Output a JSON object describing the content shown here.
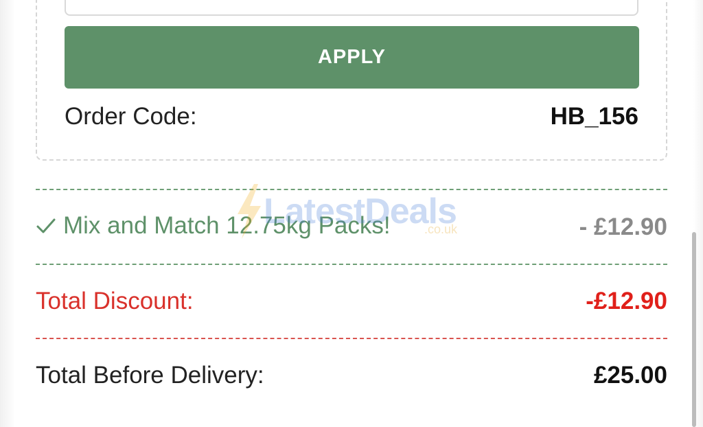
{
  "promo": {
    "input_value": "",
    "apply_label": "APPLY",
    "order_code_label": "Order Code:",
    "order_code_value": "HB_156"
  },
  "summary": {
    "promotion_label": "Mix and Match 12.75kg Packs!",
    "promotion_amount": "- £12.90",
    "total_discount_label": "Total Discount:",
    "total_discount_amount": "-£12.90",
    "total_before_delivery_label": "Total Before Delivery:",
    "total_before_delivery_amount": "£25.00"
  },
  "watermark": {
    "brand": "LatestDeals",
    "domain": ".co.uk"
  },
  "icons": {
    "check": "check-icon",
    "bolt": "lightning-bolt-icon"
  },
  "colors": {
    "apply_button": "#5e9169",
    "promotion_text": "#5e9169",
    "discount_text": "#e0201a"
  }
}
